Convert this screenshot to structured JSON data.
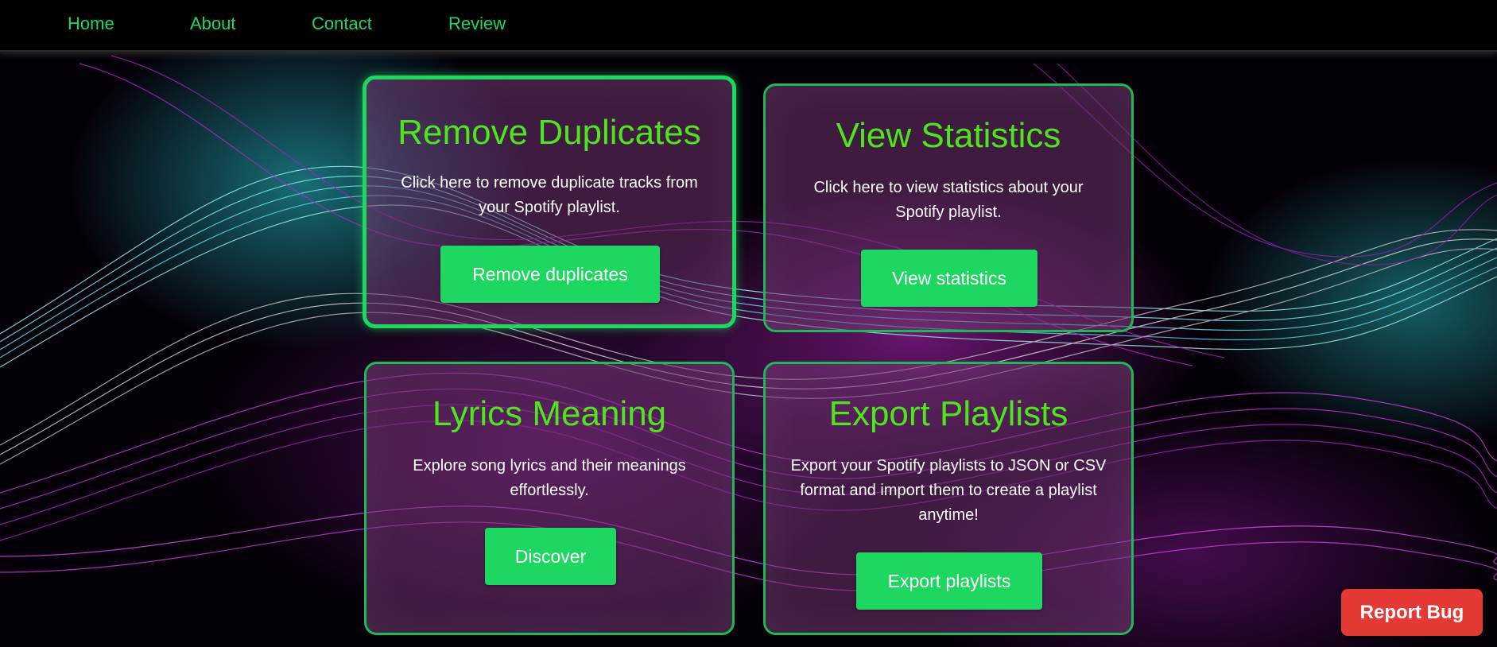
{
  "nav": {
    "links": [
      {
        "label": "Home"
      },
      {
        "label": "About"
      },
      {
        "label": "Contact"
      },
      {
        "label": "Review"
      }
    ]
  },
  "cards": {
    "remove_duplicates": {
      "title": "Remove Duplicates",
      "description": "Click here to remove duplicate tracks from your Spotify playlist.",
      "button_label": "Remove duplicates",
      "state": "focused"
    },
    "view_statistics": {
      "title": "View Statistics",
      "description": "Click here to view statistics about your Spotify playlist.",
      "button_label": "View statistics"
    },
    "lyrics_meaning": {
      "title": "Lyrics Meaning",
      "description": "Explore song lyrics and their meanings effortlessly.",
      "button_label": "Discover"
    },
    "export_playlists": {
      "title": "Export Playlists",
      "description": "Export your Spotify playlists to JSON or CSV format and import them to create a playlist anytime!",
      "button_label": "Export playlists"
    }
  },
  "report_bug": {
    "label": "Report Bug"
  },
  "colors": {
    "accent_green": "#1ed760",
    "title_green": "#4ee51f",
    "report_red": "#e53935",
    "navbar_bg": "#000000",
    "card_bg": "#6e326e"
  }
}
